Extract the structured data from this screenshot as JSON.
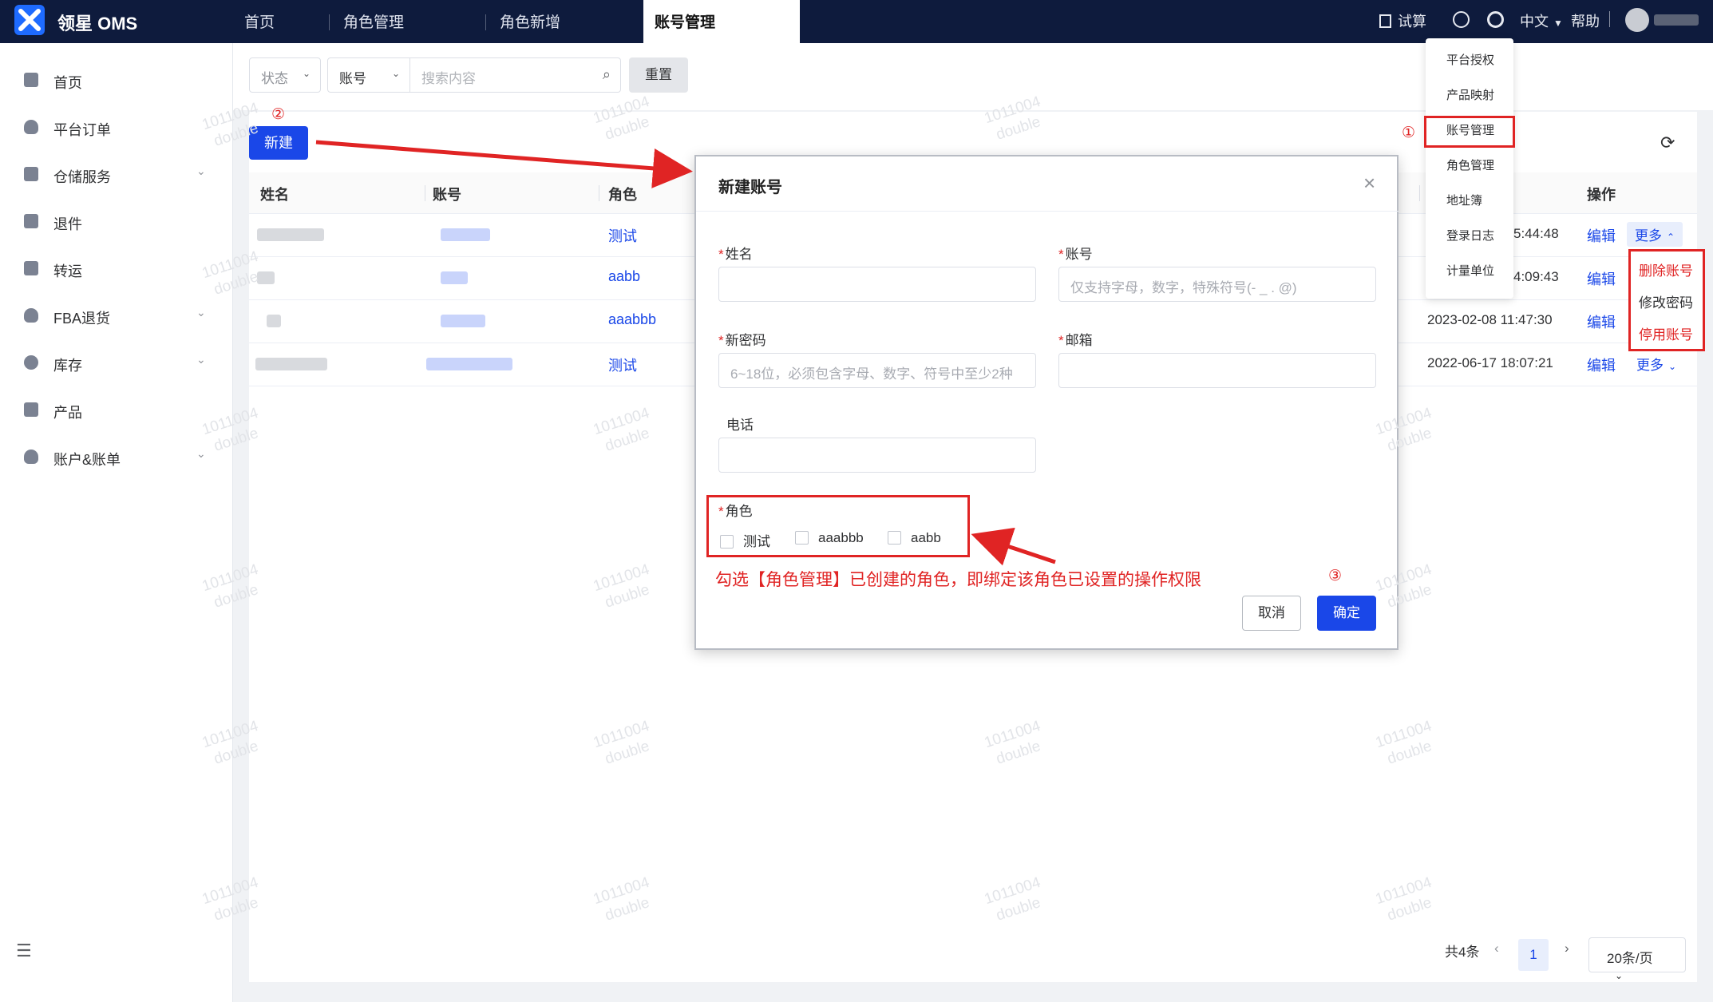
{
  "app": {
    "name": "领星 OMS"
  },
  "tabs": [
    {
      "label": "首页"
    },
    {
      "label": "角色管理"
    },
    {
      "label": "角色新增"
    },
    {
      "label": "账号管理"
    }
  ],
  "topbar": {
    "trial": "试算",
    "language": "中文",
    "help": "帮助"
  },
  "sidebar": {
    "items": [
      {
        "label": "首页"
      },
      {
        "label": "平台订单"
      },
      {
        "label": "仓储服务"
      },
      {
        "label": "退件"
      },
      {
        "label": "转运"
      },
      {
        "label": "FBA退货"
      },
      {
        "label": "库存"
      },
      {
        "label": "产品"
      },
      {
        "label": "账户&账单"
      }
    ]
  },
  "filters": {
    "status_placeholder": "状态",
    "field_select": "账号",
    "search_placeholder": "搜索内容",
    "reset_label": "重置"
  },
  "toolbar": {
    "new_label": "新建"
  },
  "table": {
    "headers": {
      "name": "姓名",
      "account": "账号",
      "role": "角色",
      "ops": "操作"
    },
    "rows": [
      {
        "role": "测试",
        "time": "5:44:48",
        "edit": "编辑",
        "more": "更多"
      },
      {
        "role": "aabb",
        "time": "4:09:43",
        "edit": "编辑",
        "more": ""
      },
      {
        "role": "aaabbb",
        "time": "2023-02-08 11:47:30",
        "edit": "编辑",
        "more": ""
      },
      {
        "role": "测试",
        "time": "2022-06-17 18:07:21",
        "edit": "编辑",
        "more": "更多"
      }
    ]
  },
  "settings_menu": {
    "items": [
      {
        "label": "平台授权"
      },
      {
        "label": "产品映射"
      },
      {
        "label": "账号管理"
      },
      {
        "label": "角色管理"
      },
      {
        "label": "地址簿"
      },
      {
        "label": "登录日志"
      },
      {
        "label": "计量单位"
      }
    ]
  },
  "more_menu": {
    "items": [
      {
        "label": "删除账号"
      },
      {
        "label": "修改密码"
      },
      {
        "label": "停用账号"
      }
    ]
  },
  "pagination": {
    "total": "共4条",
    "current": "1",
    "page_size": "20条/页"
  },
  "modal": {
    "title": "新建账号",
    "fields": {
      "name_label": "姓名",
      "account_label": "账号",
      "account_placeholder": "仅支持字母，数字，特殊符号(- _ . @)",
      "password_label": "新密码",
      "password_placeholder": "6~18位，必须包含字母、数字、符号中至少2种",
      "email_label": "邮箱",
      "phone_label": "电话",
      "role_label": "角色",
      "role_options": [
        "测试",
        "aaabbb",
        "aabb"
      ]
    },
    "cancel_label": "取消",
    "ok_label": "确定"
  },
  "annotations": {
    "step1": "①",
    "step2": "②",
    "step3": "③",
    "note": "勾选【角色管理】已创建的角色，即绑定该角色已设置的操作权限"
  },
  "watermark": {
    "line1": "1011004",
    "line2": "double"
  },
  "colors": {
    "primary": "#1a47e8",
    "topbar": "#0e1b3d",
    "annotation": "#e02424"
  }
}
